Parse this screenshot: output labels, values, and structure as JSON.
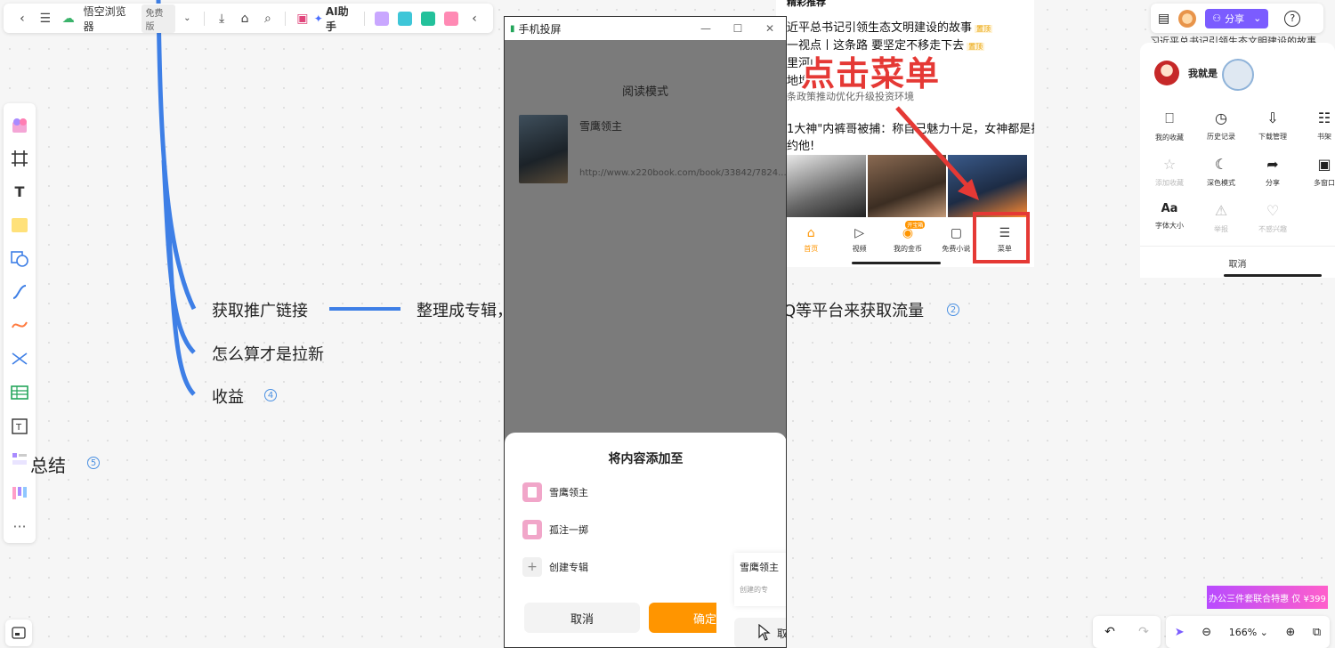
{
  "toolbar": {
    "browser_title": "悟空浏览器",
    "free_badge": "免费版",
    "ai_label": "AI助手"
  },
  "mindmap": {
    "node_link": "获取推广链接",
    "node_album_left": "整理成专辑，",
    "node_album_right": "Q等平台来获取流量",
    "node_newuser": "怎么算才是拉新",
    "node_income": "收益",
    "node_summary": "总结",
    "count_income": "4",
    "count_summary": "5",
    "count_album": "2"
  },
  "phone": {
    "window_title": "手机投屏",
    "reading_mode": "阅读模式",
    "book_name": "雪鹰领主",
    "book_url": "http://www.x220book.com/book/33842/7824...",
    "sheet_title": "将内容添加至",
    "options": [
      "雪鹰领主",
      "孤注一掷"
    ],
    "create_album": "创建专辑",
    "cancel": "取消",
    "confirm": "确定",
    "card_title": "雪鹰领主",
    "card_sub": "创建的专",
    "card_btn": "取"
  },
  "mid": {
    "section": "精彩推荐",
    "lines": [
      "近平总书记引领生态文明建设的故事",
      "一视点丨这条路 要坚定不移走下去",
      "里河山",
      "地增",
      "条政策推动优化升级投资环境"
    ],
    "tag_top": "置顶",
    "headline1": "1大神\"内裤哥被捕：称自己魅力十足，女神都是排",
    "headline2": "约他!",
    "callout": "点击菜单",
    "nav": [
      "首页",
      "视频",
      "我的金币",
      "免费小说",
      "菜单"
    ],
    "nav_badge": "开宝箱"
  },
  "right": {
    "partial_top": "习近平总书记引领生态文明建设的故事",
    "username": "我就是",
    "items": [
      {
        "label": "我的收藏",
        "icon": "bookmark-icon",
        "dim": false
      },
      {
        "label": "历史记录",
        "icon": "clock-icon",
        "dim": false
      },
      {
        "label": "下载管理",
        "icon": "download-icon",
        "dim": false
      },
      {
        "label": "书架",
        "icon": "shelf-icon",
        "dim": false
      },
      {
        "label": "添加收藏",
        "icon": "star-icon",
        "dim": true
      },
      {
        "label": "深色模式",
        "icon": "moon-icon",
        "dim": false
      },
      {
        "label": "分享",
        "icon": "share-icon",
        "dim": false
      },
      {
        "label": "多窗口",
        "icon": "window-icon",
        "dim": false
      },
      {
        "label": "字体大小",
        "icon": "font-icon",
        "dim": false
      },
      {
        "label": "举报",
        "icon": "warning-icon",
        "dim": true
      },
      {
        "label": "不感兴趣",
        "icon": "heart-broken-icon",
        "dim": true
      }
    ],
    "cancel": "取消",
    "share_btn": "分享"
  },
  "bottom": {
    "zoom": "166%",
    "promo": "办公三件套联合特惠 仅 ¥399"
  },
  "colors": {
    "accent": "#4a90e2",
    "orange": "#ff9500",
    "red": "#e53935",
    "purple": "#7b5cff"
  }
}
